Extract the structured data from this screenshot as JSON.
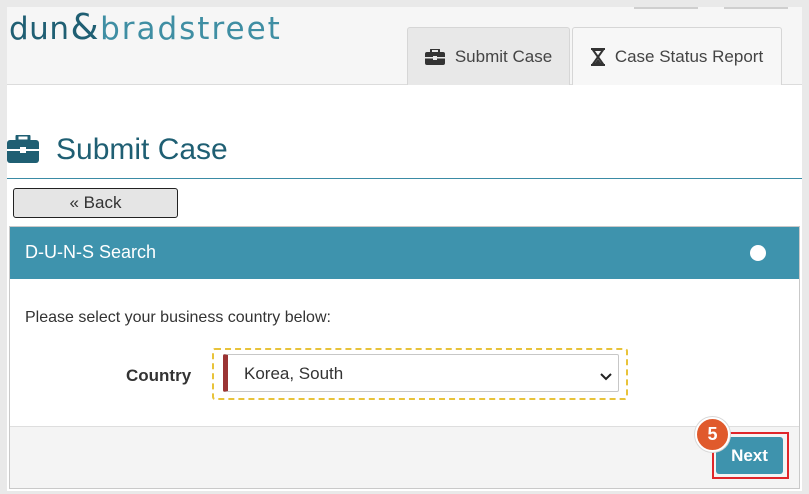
{
  "brand": {
    "part1": "dun",
    "amp": "&",
    "part2": "bradstreet"
  },
  "tabs": [
    {
      "label": "Submit Case",
      "icon": "briefcase-icon"
    },
    {
      "label": "Case Status Report",
      "icon": "hourglass-icon"
    }
  ],
  "page": {
    "title": "Submit Case",
    "title_icon": "briefcase-icon"
  },
  "back_button": {
    "label": "« Back"
  },
  "panel": {
    "title": "D-U-N-S Search",
    "prompt": "Please select your business country below:",
    "country_label": "Country",
    "country_value": "Korea, South"
  },
  "next_button": {
    "label": "Next"
  },
  "step_badge": {
    "number": "5"
  },
  "colors": {
    "brand_teal": "#1f5f73",
    "panel_header": "#3e93ad",
    "highlight_dashed": "#e8c33a",
    "select_accent": "#9b3434",
    "annotation_red": "#e0262a",
    "badge_orange": "#e05a2c"
  }
}
